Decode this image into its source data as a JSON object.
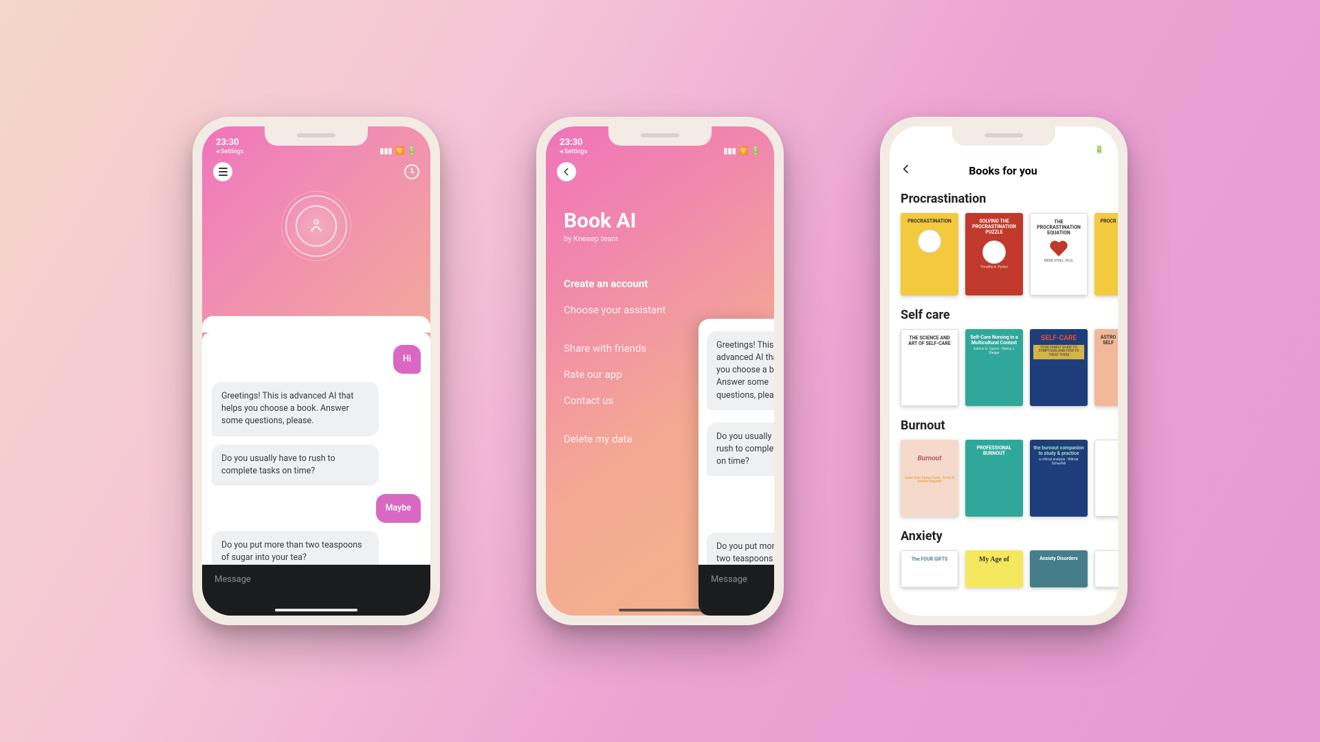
{
  "status": {
    "time": "23:30",
    "back_hint": "◂ Settings",
    "signal_icon": "▮▮▮",
    "wifi_icon": "🛜",
    "battery_icon": "🔋"
  },
  "chat": {
    "messages": [
      {
        "role": "user",
        "text": "Hi"
      },
      {
        "role": "ai",
        "text": "Greetings! This is advanced AI that helps you choose a book. Answer some questions, please."
      },
      {
        "role": "ai",
        "text": "Do you usually have to rush to complete tasks on time?"
      },
      {
        "role": "user",
        "text": "Maybe"
      },
      {
        "role": "ai",
        "text": "Do you put more than two teaspoons of sugar into your tea?"
      }
    ],
    "input_placeholder": "Message"
  },
  "drawer": {
    "title": "Book AI",
    "subtitle": "by Kneвер team",
    "items": [
      {
        "label": "Create an account",
        "strong": true
      },
      {
        "label": "Choose your assistant",
        "strong": false
      }
    ],
    "items2": [
      {
        "label": "Share with friends"
      },
      {
        "label": "Rate our app"
      },
      {
        "label": "Contact us"
      }
    ],
    "items3": [
      {
        "label": "Delete my data"
      }
    ],
    "peek": {
      "msg1": "Greetings! This is advanced AI that helps you choose a book. Answer some questions, please.",
      "msg2": "Do you usually have to rush to complete tasks on time?",
      "msg3": "Do you put more than two teaspoons of sugar into your tea?",
      "input_placeholder": "Message"
    }
  },
  "books": {
    "header_title": "Books for you",
    "sections": {
      "procrastination": {
        "label": "Procrastination",
        "items": [
          "PROCRASTINATION",
          "SOLVING THE PROCRASTINATION PUZZLE",
          "THE PROCRASTINATION EQUATION",
          "PROCR"
        ],
        "subs": [
          "",
          "Timothy A. Pychyl",
          "PIERS STEEL, Ph.D.",
          ""
        ]
      },
      "selfcare": {
        "label": "Self care",
        "items": [
          "THE SCIENCE AND ART OF SELF-CARE",
          "Self-Care Nursing in a Multicultural Context",
          "SELF-CARE",
          "ASTRO SELF"
        ],
        "subs": [
          "",
          "Juliene G. Lipson · Nancy J. Steiger",
          "YOUR FAMILY GUIDE TO SYMPTOMS AND HOW TO TREAT THEM",
          ""
        ]
      },
      "burnout": {
        "label": "Burnout",
        "items": [
          "Burnout",
          "PROFESSIONAL BURNOUT",
          "the burnout companion to study & practice",
          ""
        ],
        "subs": [
          "Solve Your Stress Cycle · Emily & Amelia Nagoski",
          "",
          "a critical analysis · Wilmar Schaufeli",
          ""
        ]
      },
      "anxiety": {
        "label": "Anxiety",
        "items": [
          "The FOUR GIFTS",
          "My Age of",
          "Anxiety Disorders",
          ""
        ]
      }
    }
  }
}
